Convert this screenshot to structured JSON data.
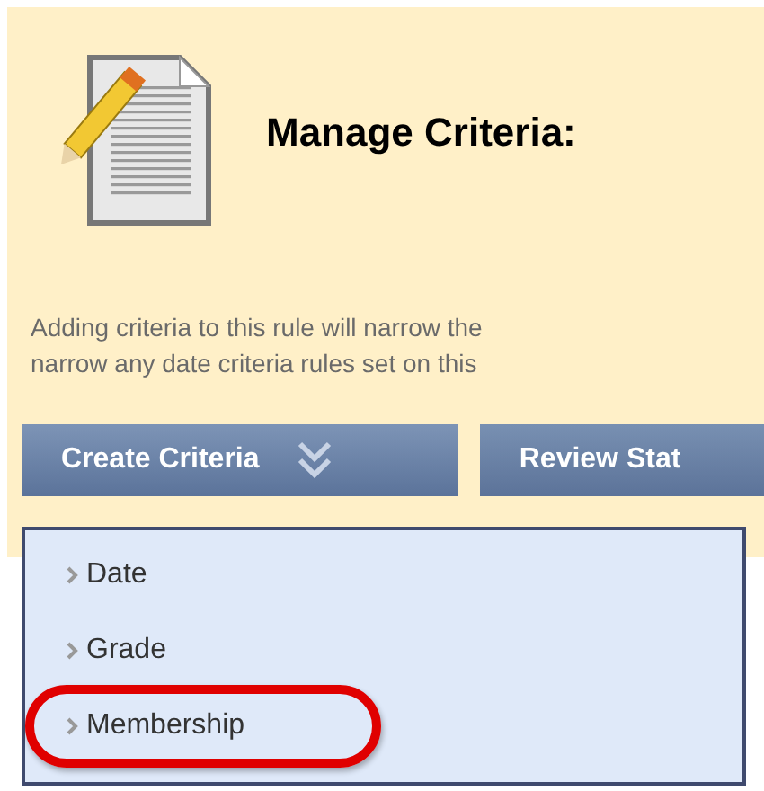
{
  "header": {
    "title": "Manage Criteria:",
    "description": [
      "Adding criteria to this rule will narrow the",
      "narrow any date criteria rules set on this"
    ]
  },
  "action_bar": [
    {
      "label": "Create Criteria",
      "kind": "menu"
    },
    {
      "label": "Review Stat",
      "kind": "plain"
    }
  ],
  "menu_items": [
    {
      "label": "Date",
      "highlighted": false
    },
    {
      "label": "Grade",
      "highlighted": false
    },
    {
      "label": "Membership",
      "highlighted": true
    }
  ]
}
